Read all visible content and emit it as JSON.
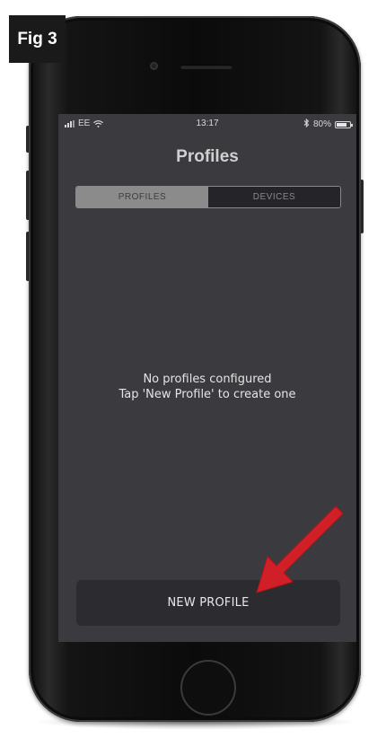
{
  "figure": {
    "label": "Fig 3"
  },
  "status_bar": {
    "carrier": "EE",
    "time": "13:17",
    "battery_percent": "80%",
    "battery_level": 0.8
  },
  "header": {
    "title": "Profiles"
  },
  "tabs": [
    {
      "label": "PROFILES",
      "selected": true
    },
    {
      "label": "DEVICES",
      "selected": false
    }
  ],
  "empty_state": {
    "line1": "No profiles configured",
    "line2": "Tap 'New Profile' to create one"
  },
  "actions": {
    "new_profile_label": "NEW PROFILE"
  },
  "colors": {
    "screen_bg": "#3b3a3f",
    "button_bg": "#2c2b2f",
    "tab_active_bg": "#8b8b8b",
    "tab_inactive_bg": "#252428",
    "arrow": "#d01f26"
  },
  "icons": [
    "signal-icon",
    "wifi-icon",
    "bluetooth-icon",
    "battery-icon",
    "arrow-icon"
  ]
}
